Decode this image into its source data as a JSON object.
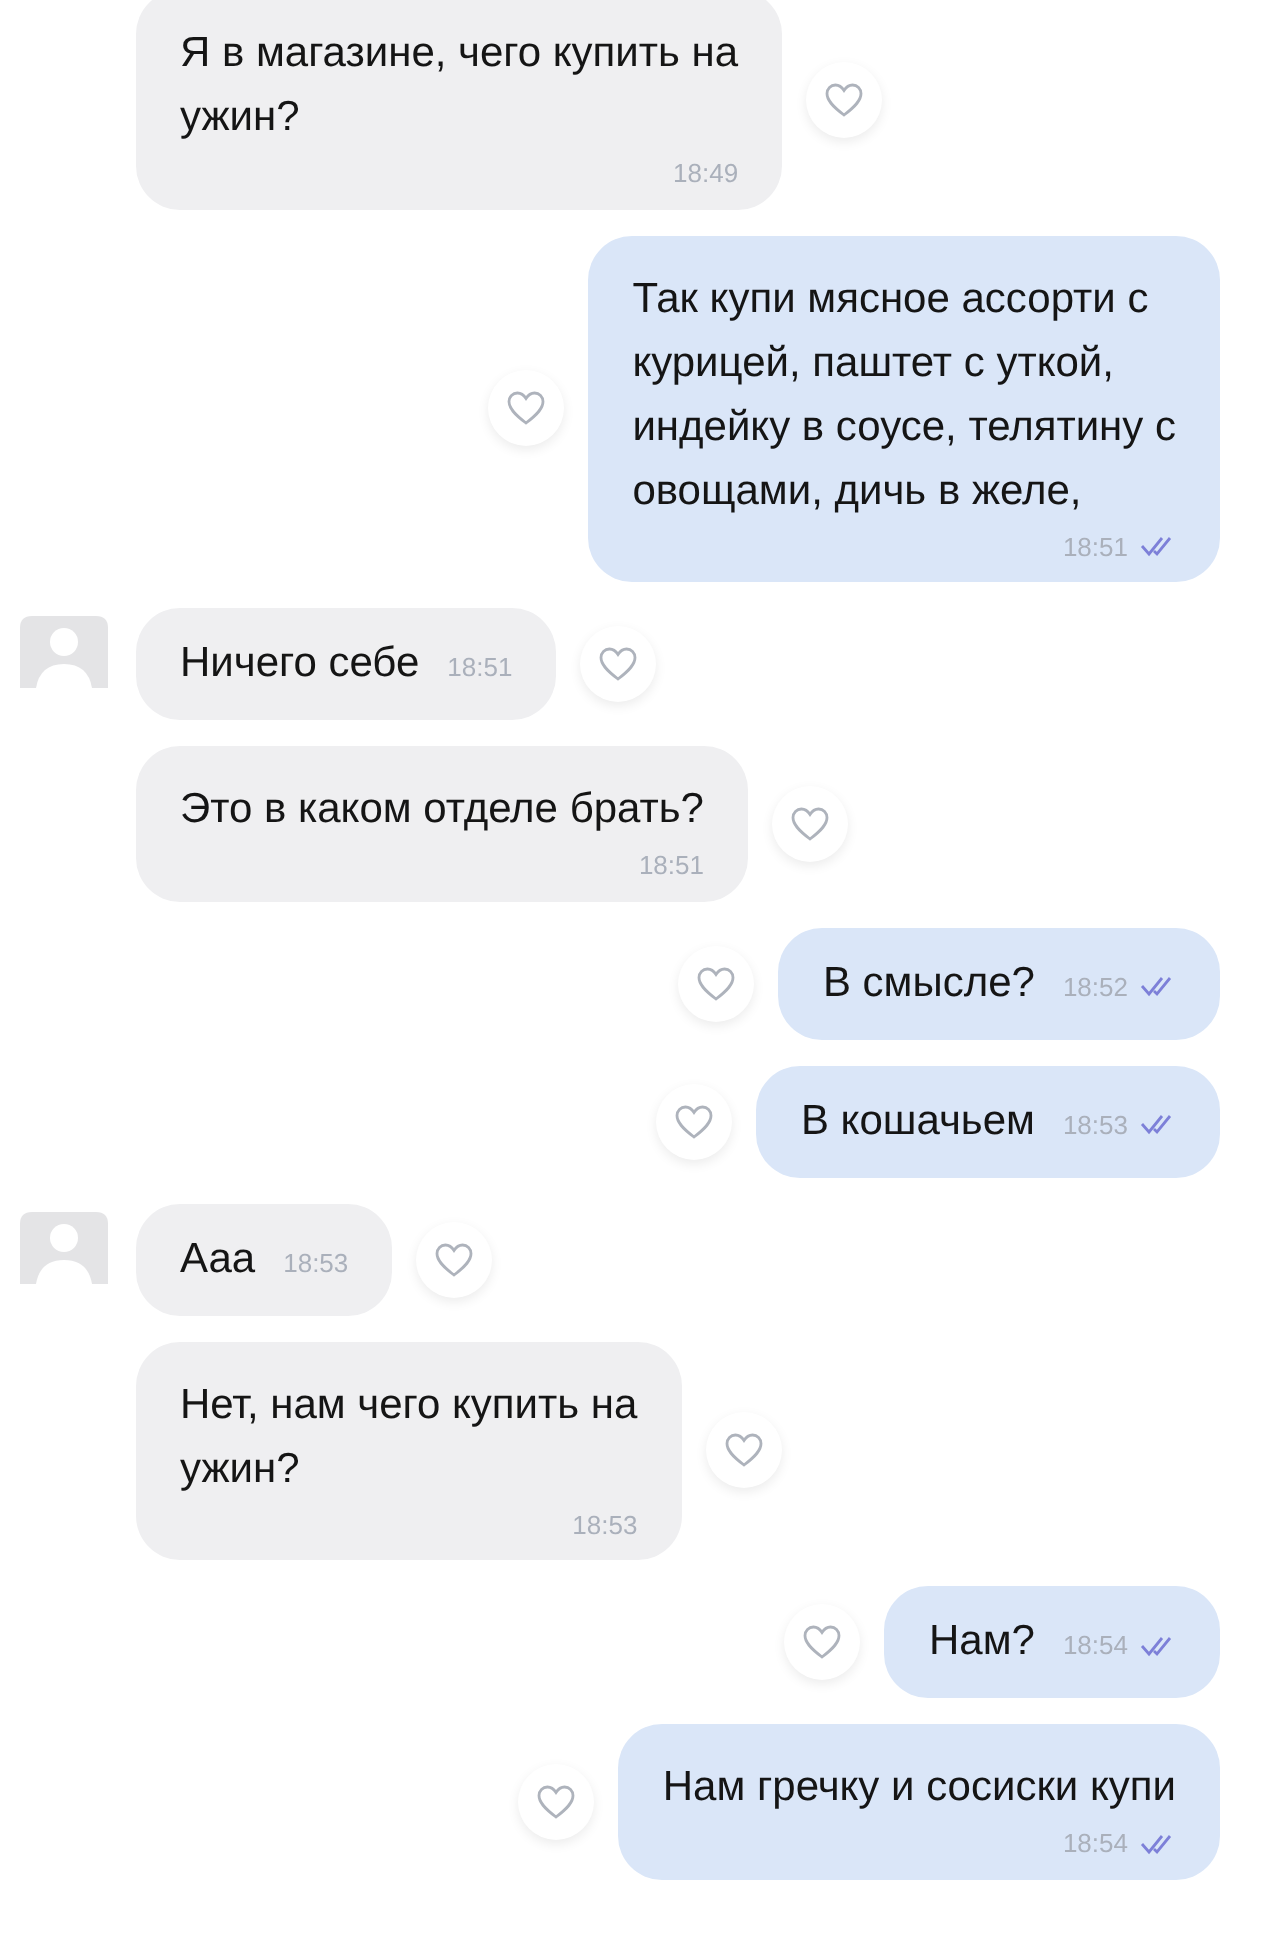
{
  "messages": [
    {
      "kind": "incoming",
      "avatar": false,
      "lines": [
        "Я в магазине, чего купить на",
        "ужин?"
      ],
      "time": "18:49",
      "time_below": true
    },
    {
      "kind": "outgoing",
      "lines": [
        "Так купи мясное ассорти с",
        "курицей, паштет с уткой,",
        "индейку в соусе, телятину с",
        "овощами, дичь в желе,"
      ],
      "time": "18:51",
      "time_below": true,
      "read": true
    },
    {
      "kind": "incoming",
      "avatar": true,
      "lines": [
        "Ничего себе"
      ],
      "time": "18:51",
      "time_below": false
    },
    {
      "kind": "incoming",
      "avatar": false,
      "lines": [
        "Это в каком отделе брать?"
      ],
      "time": "18:51",
      "time_below": true
    },
    {
      "kind": "outgoing",
      "lines": [
        "В смысле?"
      ],
      "time": "18:52",
      "time_below": false,
      "read": true
    },
    {
      "kind": "outgoing",
      "lines": [
        "В кошачьем"
      ],
      "time": "18:53",
      "time_below": false,
      "read": true
    },
    {
      "kind": "incoming",
      "avatar": true,
      "lines": [
        "Ааа"
      ],
      "time": "18:53",
      "time_below": false
    },
    {
      "kind": "incoming",
      "avatar": false,
      "lines": [
        "Нет, нам чего купить на",
        "ужин?"
      ],
      "time": "18:53",
      "time_below": true
    },
    {
      "kind": "outgoing",
      "lines": [
        "Нам?"
      ],
      "time": "18:54",
      "time_below": false,
      "read": true
    },
    {
      "kind": "outgoing",
      "lines": [
        "Нам гречку и сосиски купи"
      ],
      "time": "18:54",
      "time_below": true,
      "read": true
    }
  ]
}
